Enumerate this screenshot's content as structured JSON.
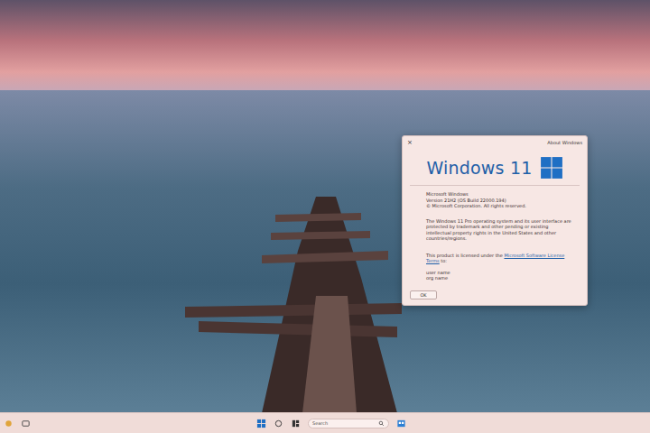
{
  "window": {
    "title": "About Windows",
    "close": "×"
  },
  "logo": {
    "text": "Windows 11"
  },
  "info": [
    "Microsoft Windows",
    "Version 21H2 (OS Build 22000.194)",
    "© Microsoft Corporation. All rights reserved."
  ],
  "legal": "The Windows 11 Pro operating system and its user interface are protected by trademark and other pending or existing intellectual property rights in the United States and other countries/regions.",
  "license": {
    "prefix": "This product is licensed under the ",
    "link": "Microsoft Software License Terms",
    "suffix": " to:"
  },
  "licensees": [
    "user name",
    "org name"
  ],
  "buttons": [
    "OK"
  ],
  "taskbar": {
    "search": {
      "placeholder": "Search"
    }
  }
}
